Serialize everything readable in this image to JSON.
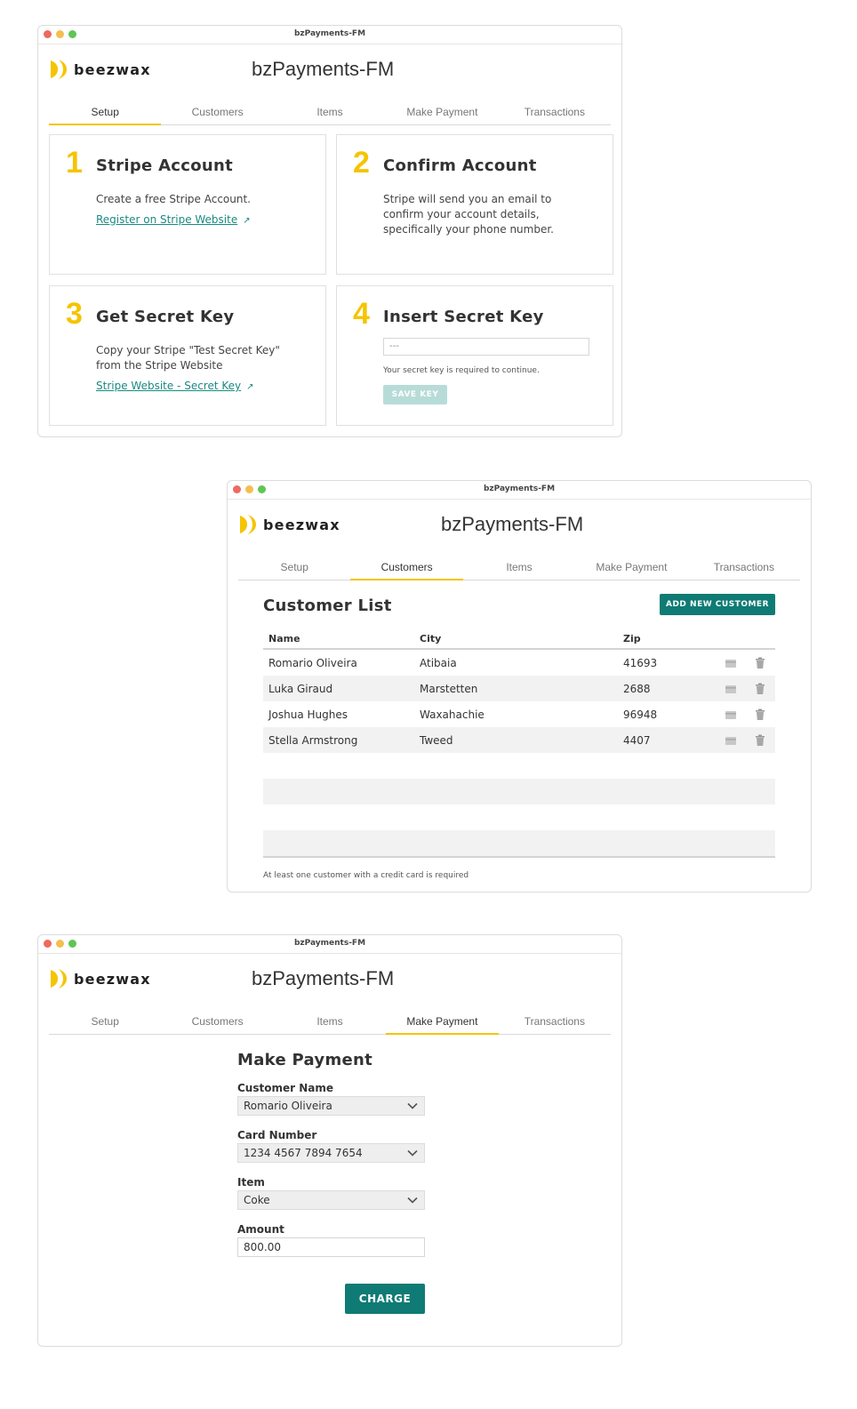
{
  "window_title": "bzPayments-FM",
  "app_title": "bzPayments-FM",
  "logo_text": "beezwax",
  "tabs": [
    "Setup",
    "Customers",
    "Items",
    "Make Payment",
    "Transactions"
  ],
  "colors": {
    "accent_yellow": "#f5c400",
    "teal": "#0f7b74",
    "link": "#1a8a82"
  },
  "setup": {
    "cards": [
      {
        "num": "1",
        "title": "Stripe Account",
        "text": "Create a free Stripe Account.",
        "link": "Register on Stripe Website"
      },
      {
        "num": "2",
        "title": "Confirm Account",
        "text": "Stripe will send you an email to confirm your account details, specifically your phone number."
      },
      {
        "num": "3",
        "title": "Get Secret Key",
        "text": "Copy your Stripe \"Test Secret Key\" from the Stripe Website",
        "link": "Stripe Website - Secret Key"
      },
      {
        "num": "4",
        "title": "Insert Secret Key",
        "input_value": "---",
        "hint": "Your secret key is required to continue.",
        "button": "SAVE KEY"
      }
    ]
  },
  "customers": {
    "heading": "Customer List",
    "add_button": "ADD NEW CUSTOMER",
    "columns": [
      "Name",
      "City",
      "Zip"
    ],
    "rows": [
      [
        "Romario Oliveira",
        "Atibaia",
        "41693"
      ],
      [
        "Luka Giraud",
        "Marstetten",
        "2688"
      ],
      [
        "Joshua Hughes",
        "Waxahachie",
        "96948"
      ],
      [
        "Stella Armstrong",
        "Tweed",
        "4407"
      ]
    ],
    "footnote": "At least one customer with a credit card is required"
  },
  "payment": {
    "heading": "Make Payment",
    "customer_label": "Customer Name",
    "customer_value": "Romario Oliveira",
    "card_label": "Card Number",
    "card_value": "1234 4567 7894 7654",
    "item_label": "Item",
    "item_value": "Coke",
    "amount_label": "Amount",
    "amount_value": "800.00",
    "charge_button": "CHARGE"
  }
}
